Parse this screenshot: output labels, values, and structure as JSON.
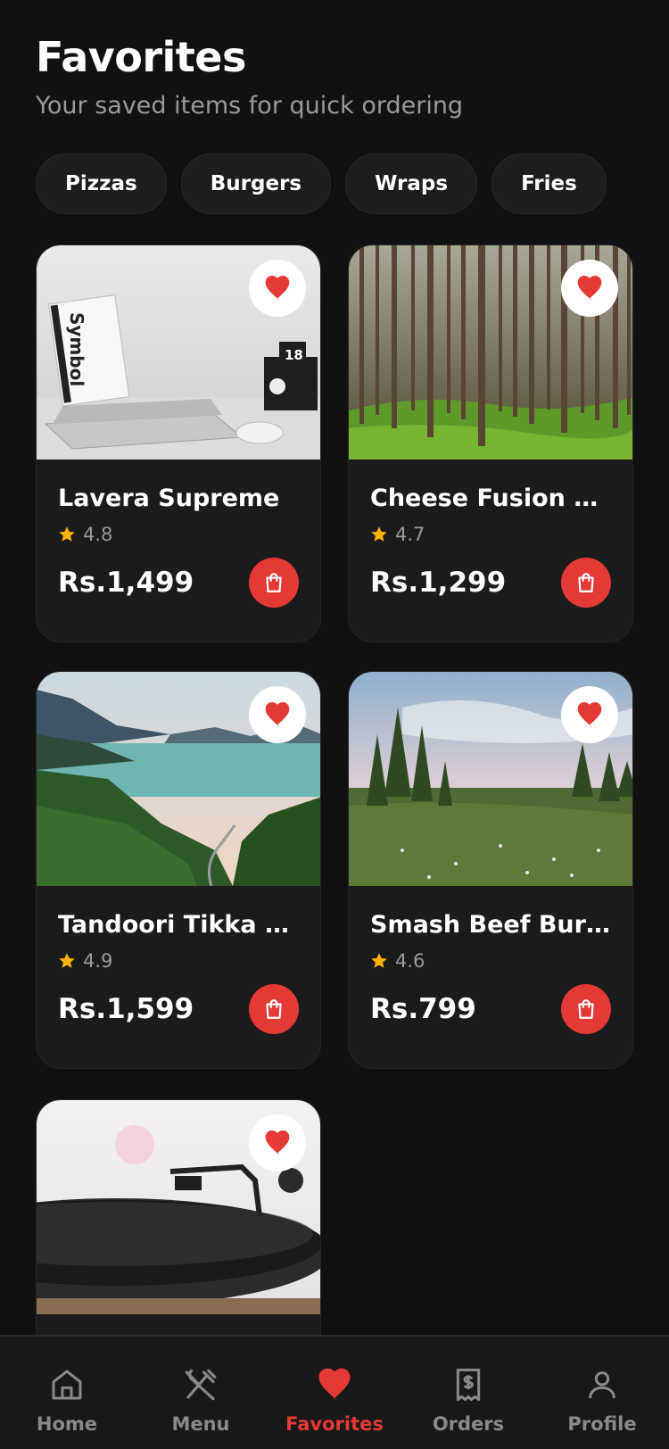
{
  "header": {
    "title": "Favorites",
    "subtitle": "Your saved items for quick ordering"
  },
  "filters": [
    "Pizzas",
    "Burgers",
    "Wraps",
    "Fries"
  ],
  "items": [
    {
      "name": "Lavera Supreme",
      "rating": "4.8",
      "price": "Rs.1,499",
      "image": "laptop-desk-photo",
      "favorited": true
    },
    {
      "name": "Cheese Fusion Bl…",
      "rating": "4.7",
      "price": "Rs.1,299",
      "image": "pine-forest-photo",
      "favorited": true
    },
    {
      "name": "Tandoori Tikka Bl…",
      "rating": "4.9",
      "price": "Rs.1,599",
      "image": "mountain-lake-photo",
      "favorited": true
    },
    {
      "name": "Smash Beef Burger",
      "rating": "4.6",
      "price": "Rs.799",
      "image": "meadow-trees-photo",
      "favorited": true
    },
    {
      "name": "",
      "rating": "",
      "price": "",
      "image": "record-player-photo",
      "favorited": true
    }
  ],
  "nav": [
    {
      "label": "Home",
      "icon": "home-icon",
      "active": false
    },
    {
      "label": "Menu",
      "icon": "utensils-icon",
      "active": false
    },
    {
      "label": "Favorites",
      "icon": "heart-icon",
      "active": true
    },
    {
      "label": "Orders",
      "icon": "receipt-icon",
      "active": false
    },
    {
      "label": "Profile",
      "icon": "user-icon",
      "active": false
    }
  ],
  "colors": {
    "background": "#111111",
    "card": "#1b1b1b",
    "accent": "#e53935",
    "star": "#ffb300",
    "muted": "#9a9a9a"
  }
}
